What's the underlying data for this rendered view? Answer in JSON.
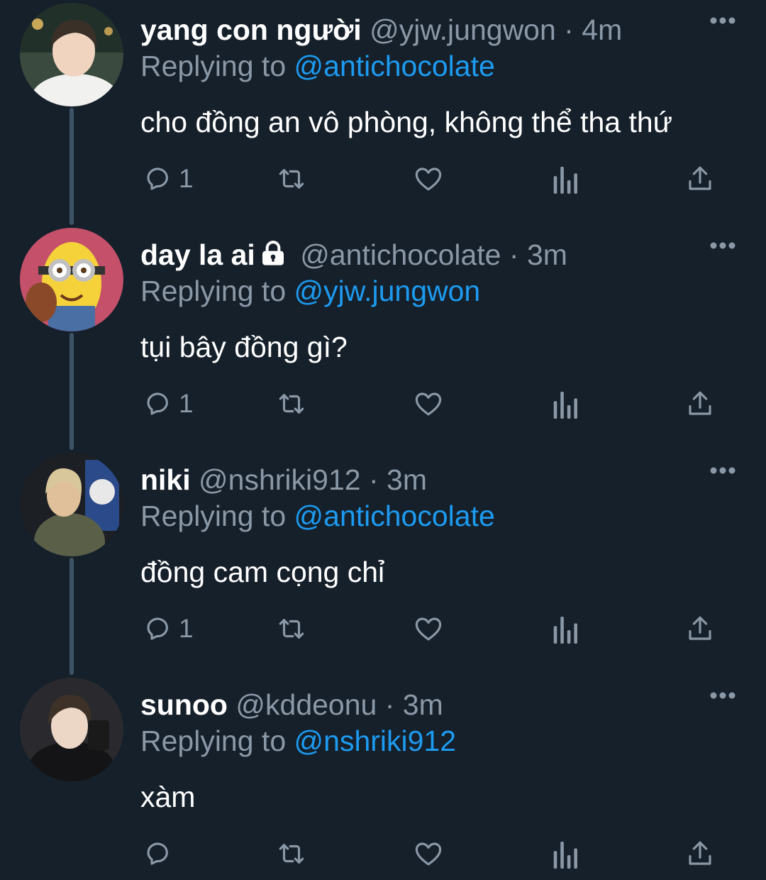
{
  "colors": {
    "background": "#15202b",
    "text": "#ffffff",
    "secondary": "#8b98a5",
    "accent": "#1d9bf0",
    "thread_line": "#3d5466"
  },
  "icons": {
    "reply": "reply-icon",
    "retweet": "retweet-icon",
    "like": "heart-icon",
    "views": "analytics-icon",
    "share": "share-icon",
    "more": "more-icon",
    "protected": "lock-icon"
  },
  "tweets": [
    {
      "display_name": "yang con người",
      "handle": "@yjw.jungwon",
      "separator": "·",
      "time": "4m",
      "replying_prefix": "Replying to",
      "replying_to": "@antichocolate",
      "text": "cho đồng an vô phòng, không thể tha thứ",
      "reply_count": "1",
      "protected": false
    },
    {
      "display_name": "day la ai",
      "handle": "@antichocolate",
      "separator": "·",
      "time": "3m",
      "replying_prefix": "Replying to",
      "replying_to": "@yjw.jungwon",
      "text": "tụi bây đồng gì?",
      "reply_count": "1",
      "protected": true
    },
    {
      "display_name": "niki",
      "handle": "@nshriki912",
      "separator": "·",
      "time": "3m",
      "replying_prefix": "Replying to",
      "replying_to": "@antichocolate",
      "text": "đồng cam cọng chỉ",
      "reply_count": "1",
      "protected": false
    },
    {
      "display_name": "sunoo",
      "handle": "@kddeonu",
      "separator": "·",
      "time": "3m",
      "replying_prefix": "Replying to",
      "replying_to": "@nshriki912",
      "text": "xàm",
      "reply_count": "",
      "protected": false
    }
  ]
}
